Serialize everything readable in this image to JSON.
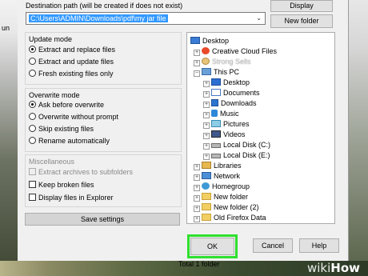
{
  "background": {
    "left_text": "un"
  },
  "destination": {
    "label": "Destination path (will be created if does not exist)",
    "path_value": "C:\\Users\\ADMIN\\Downloads\\pdf\\my jar file"
  },
  "buttons": {
    "display": "Display",
    "new_folder": "New folder",
    "save_settings": "Save settings",
    "ok": "OK",
    "cancel": "Cancel",
    "help": "Help"
  },
  "update_mode": {
    "title": "Update mode",
    "options": [
      {
        "label": "Extract and replace files",
        "selected": true
      },
      {
        "label": "Extract and update files",
        "selected": false
      },
      {
        "label": "Fresh existing files only",
        "selected": false
      }
    ]
  },
  "overwrite_mode": {
    "title": "Overwrite mode",
    "options": [
      {
        "label": "Ask before overwrite",
        "selected": true
      },
      {
        "label": "Overwrite without prompt",
        "selected": false
      },
      {
        "label": "Skip existing files",
        "selected": false
      },
      {
        "label": "Rename automatically",
        "selected": false
      }
    ]
  },
  "miscellaneous": {
    "title": "Miscellaneous",
    "options": [
      {
        "label": "Extract archives to subfolders",
        "checked": false,
        "disabled": true
      },
      {
        "label": "Keep broken files",
        "checked": false,
        "disabled": false
      },
      {
        "label": "Display files in Explorer",
        "checked": false,
        "disabled": false
      }
    ]
  },
  "tree": {
    "items": [
      {
        "label": "Desktop",
        "icon": "desktop-icon"
      },
      {
        "label": "Creative Cloud Files",
        "icon": "creative-cloud-icon"
      },
      {
        "label": "Strong Sells",
        "icon": "user-folder-icon"
      },
      {
        "label": "This PC",
        "icon": "this-pc-icon"
      },
      {
        "label": "Desktop",
        "icon": "desktop-folder-icon"
      },
      {
        "label": "Documents",
        "icon": "documents-icon"
      },
      {
        "label": "Downloads",
        "icon": "downloads-icon"
      },
      {
        "label": "Music",
        "icon": "music-icon"
      },
      {
        "label": "Pictures",
        "icon": "pictures-icon"
      },
      {
        "label": "Videos",
        "icon": "videos-icon"
      },
      {
        "label": "Local Disk (C:)",
        "icon": "disk-icon"
      },
      {
        "label": "Local Disk (E:)",
        "icon": "disk-icon"
      },
      {
        "label": "Libraries",
        "icon": "libraries-icon"
      },
      {
        "label": "Network",
        "icon": "network-icon"
      },
      {
        "label": "Homegroup",
        "icon": "homegroup-icon"
      },
      {
        "label": "New folder",
        "icon": "folder-icon"
      },
      {
        "label": "New folder (2)",
        "icon": "folder-icon"
      },
      {
        "label": "Old Firefox Data",
        "icon": "folder-icon"
      }
    ]
  },
  "status": {
    "total": "Total 1 folder"
  },
  "watermark": {
    "prefix": "wiki",
    "suffix": "How"
  },
  "colors": {
    "highlight": "#2ee02e",
    "selection": "#3399ff"
  }
}
